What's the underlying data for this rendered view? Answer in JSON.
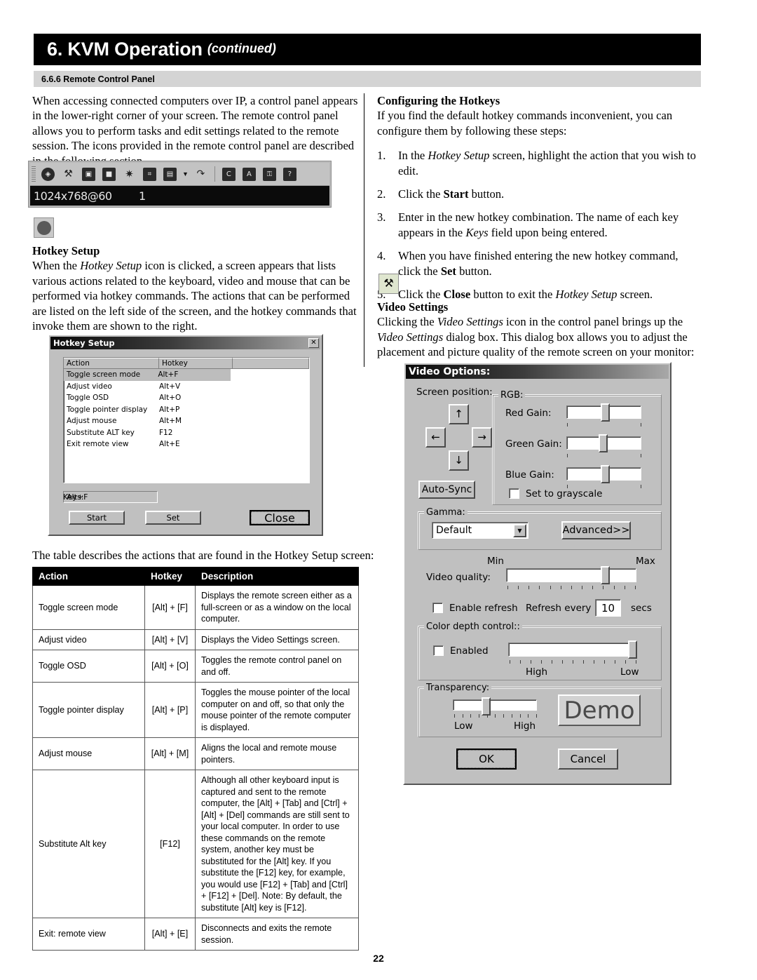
{
  "header": {
    "title": "6. KVM Operation",
    "continued": "(continued)",
    "section": "6.6.6 Remote Control Panel"
  },
  "left": {
    "intro": "When accessing connected computers over IP, a control panel appears in the lower-right corner of your screen. The remote control panel allows you to perform tasks and edit settings related to the remote session. The icons provided in the remote control panel are described in the following section.",
    "control_panel": {
      "resolution": "1024x768@60",
      "port": "1",
      "icons": [
        "globe-icon",
        "hammer-icon",
        "screen-mode-icon",
        "monitor-icon",
        "brightness-icon",
        "keyboard-icon",
        "calendar-icon",
        "dropdown-caret-icon",
        "mouse-sync-icon",
        "save-ctrl-icon",
        "save-alt-icon",
        "lock-icon",
        "help-icon"
      ]
    },
    "hotkey_setup": {
      "heading": "Hotkey Setup",
      "body_1": "When the ",
      "body_em": "Hotkey Setup",
      "body_2": " icon is clicked, a screen appears that lists various actions related to the keyboard, video and mouse that can be performed via hotkey commands. The actions that can be performed are listed on the left side of the screen, and the hotkey commands that invoke them are shown to the right."
    },
    "table_caption": "The table describes the actions that are found in the Hotkey Setup screen:"
  },
  "hotkey_dialog": {
    "title": "Hotkey Setup",
    "close_glyph": "✕",
    "columns": [
      "Action",
      "Hotkey",
      ""
    ],
    "rows": [
      {
        "action": "Toggle screen mode",
        "hotkey": "Alt+F",
        "selected": true
      },
      {
        "action": "Adjust video",
        "hotkey": "Alt+V",
        "selected": false
      },
      {
        "action": "Toggle OSD",
        "hotkey": "Alt+O",
        "selected": false
      },
      {
        "action": "Toggle pointer display",
        "hotkey": "Alt+P",
        "selected": false
      },
      {
        "action": "Adjust mouse",
        "hotkey": "Alt+M",
        "selected": false
      },
      {
        "action": "Substitute ALT key",
        "hotkey": "F12",
        "selected": false
      },
      {
        "action": "Exit remote view",
        "hotkey": "Alt+E",
        "selected": false
      }
    ],
    "keys_label": "Keys:",
    "keys_value": "Alt+F",
    "buttons": {
      "start": "Start",
      "set": "Set",
      "close": "Close"
    }
  },
  "hotkey_table": {
    "headers": [
      "Action",
      "Hotkey",
      "Description"
    ],
    "rows": [
      {
        "action": "Toggle screen mode",
        "hotkey": "[Alt] + [F]",
        "description": "Displays the remote screen either as a full-screen or as a window on the local computer."
      },
      {
        "action": "Adjust video",
        "hotkey": "[Alt] + [V]",
        "description": "Displays the Video Settings screen."
      },
      {
        "action": "Toggle OSD",
        "hotkey": "[Alt] + [O]",
        "description": "Toggles the remote control panel on and off."
      },
      {
        "action": "Toggle pointer display",
        "hotkey": "[Alt] + [P]",
        "description": "Toggles the mouse pointer of the local computer on and off, so that only the mouse pointer of the remote computer is displayed."
      },
      {
        "action": "Adjust mouse",
        "hotkey": "[Alt] + [M]",
        "description": "Aligns the local and remote mouse pointers."
      },
      {
        "action": "Substitute Alt key",
        "hotkey": "[F12]",
        "description": "Although all other keyboard input is captured and sent to the remote computer, the [Alt] + [Tab] and [Ctrl] + [Alt] + [Del] commands are still sent to your local computer. In order to use these commands on the remote system, another key must be substituted for the [Alt] key. If you substitute the [F12] key, for example, you would use [F12] + [Tab] and [Ctrl] + [F12] + [Del]. Note: By default, the substitute [Alt] key is [F12]."
      },
      {
        "action": "Exit: remote view",
        "hotkey": "[Alt] + [E]",
        "description": "Disconnects and exits the remote session."
      }
    ]
  },
  "right": {
    "configuring": {
      "heading": "Configuring the Hotkeys",
      "intro": "If you find the default hotkey commands inconvenient, you can configure them by following these steps:",
      "steps": [
        {
          "num": "1.",
          "text_parts": [
            "In the ",
            "Hotkey Setup",
            " screen, highlight the action that you wish to edit."
          ]
        },
        {
          "num": "2.",
          "text_parts": [
            "Click the ",
            "Start",
            " button."
          ]
        },
        {
          "num": "3.",
          "text_parts": [
            "Enter in the new hotkey combination. The name of each key appears in the ",
            "Keys",
            " field upon being entered."
          ]
        },
        {
          "num": "4.",
          "text_parts": [
            "When you have finished entering the new hotkey command, click the ",
            "Set",
            " button."
          ]
        },
        {
          "num": "5.",
          "text_parts": [
            "Click the ",
            "Close",
            " button to exit the ",
            "Hotkey Setup",
            " screen."
          ]
        }
      ]
    },
    "video_settings": {
      "heading": "Video Settings",
      "body_1": "Clicking the ",
      "em_1": "Video Settings",
      "body_2": " icon in the control panel brings up the ",
      "em_2": "Video Settings",
      "body_3": " dialog box. This dialog box allows you to adjust the placement and picture quality of the remote screen on your monitor:"
    }
  },
  "video_dialog": {
    "title": "Video Options:",
    "screen_position_label": "Screen position:",
    "dpad": {
      "up": "↑",
      "down": "↓",
      "left": "←",
      "right": "→"
    },
    "auto_sync": "Auto-Sync",
    "rgb": {
      "legend": "RGB:",
      "red_label": "Red Gain:",
      "green_label": "Green Gain:",
      "blue_label": "Blue Gain:",
      "red_value": 50,
      "green_value": 50,
      "blue_value": 50,
      "grayscale_label": "Set to grayscale",
      "grayscale_checked": false
    },
    "gamma": {
      "legend": "Gamma:",
      "value": "Default",
      "advanced": "Advanced>>"
    },
    "video_quality": {
      "label": "Video quality:",
      "min": "Min",
      "max": "Max",
      "value": 74
    },
    "refresh": {
      "enable_label": "Enable refresh",
      "enabled": false,
      "every_label": "Refresh every",
      "seconds_value": "10",
      "secs_label": "secs"
    },
    "color_depth": {
      "legend": "Color depth control::",
      "enabled_label": "Enabled",
      "enabled": false,
      "high_label": "High",
      "low_label": "Low",
      "value": 100
    },
    "transparency": {
      "legend": "Transparency:",
      "low_label": "Low",
      "high_label": "High",
      "value": 38,
      "preview_text": "Demo"
    },
    "buttons": {
      "ok": "OK",
      "cancel": "Cancel"
    }
  },
  "footer": {
    "page_number": "22"
  }
}
